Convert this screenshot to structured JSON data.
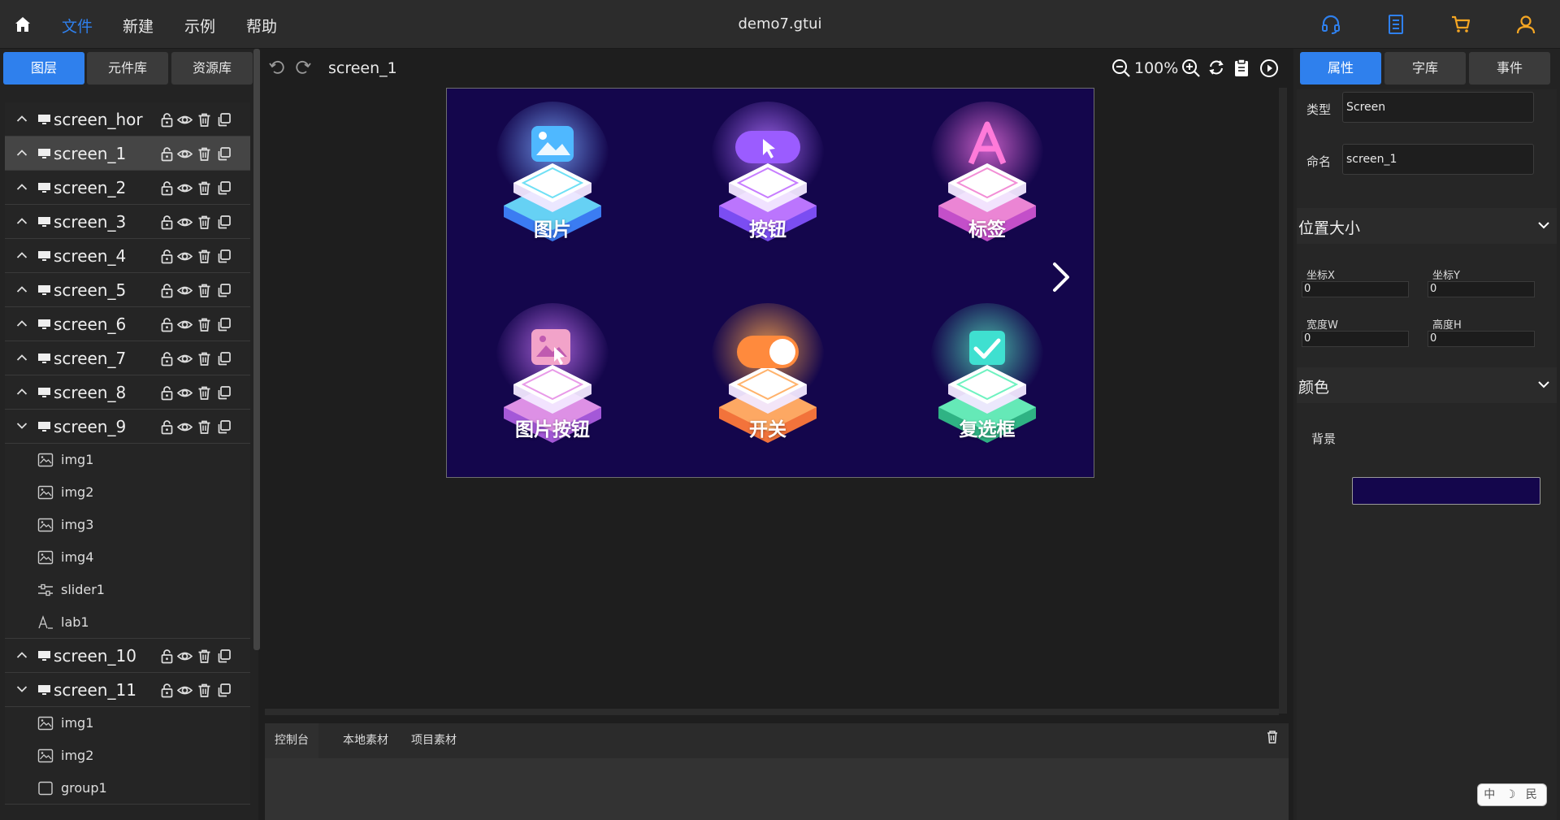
{
  "topbar": {
    "menus": [
      "文件",
      "新建",
      "示例",
      "帮助"
    ],
    "title": "demo7.gtui",
    "icons": [
      "headset-icon",
      "document-icon",
      "cart-icon",
      "user-icon"
    ],
    "accent": "#2f80ed",
    "icon_color": "#2f80ed",
    "cart_color": "#f5a623"
  },
  "left": {
    "tabs": [
      "图层",
      "元件库",
      "资源库"
    ],
    "screens": [
      {
        "name": "screen_hor",
        "expanded": false,
        "active": false,
        "children": []
      },
      {
        "name": "screen_1",
        "expanded": false,
        "active": true,
        "children": []
      },
      {
        "name": "screen_2",
        "expanded": false,
        "active": false,
        "children": []
      },
      {
        "name": "screen_3",
        "expanded": false,
        "active": false,
        "children": []
      },
      {
        "name": "screen_4",
        "expanded": false,
        "active": false,
        "children": []
      },
      {
        "name": "screen_5",
        "expanded": false,
        "active": false,
        "children": []
      },
      {
        "name": "screen_6",
        "expanded": false,
        "active": false,
        "children": []
      },
      {
        "name": "screen_7",
        "expanded": false,
        "active": false,
        "children": []
      },
      {
        "name": "screen_8",
        "expanded": false,
        "active": false,
        "children": []
      },
      {
        "name": "screen_9",
        "expanded": true,
        "active": false,
        "children": [
          {
            "name": "img1",
            "icon": "image"
          },
          {
            "name": "img2",
            "icon": "image"
          },
          {
            "name": "img3",
            "icon": "image"
          },
          {
            "name": "img4",
            "icon": "image"
          },
          {
            "name": "slider1",
            "icon": "slider"
          },
          {
            "name": "lab1",
            "icon": "label"
          }
        ]
      },
      {
        "name": "screen_10",
        "expanded": false,
        "active": false,
        "children": []
      },
      {
        "name": "screen_11",
        "expanded": true,
        "active": false,
        "children": [
          {
            "name": "img1",
            "icon": "image"
          },
          {
            "name": "img2",
            "icon": "image"
          },
          {
            "name": "group1",
            "icon": "group"
          }
        ]
      }
    ]
  },
  "center": {
    "screen_name": "screen_1",
    "zoom": "100%",
    "canvas_bg": "#14064c",
    "widgets": [
      {
        "label": "图片",
        "top": "#6fe0f5",
        "base": "#3b7cf2",
        "glow": "#7aa8ff",
        "icon": "image"
      },
      {
        "label": "按钮",
        "top": "#c77dff",
        "base": "#7b4df2",
        "glow": "#b070ff",
        "icon": "button"
      },
      {
        "label": "标签",
        "top": "#f28ed6",
        "base": "#c34fc9",
        "glow": "#e06ad8",
        "icon": "label"
      },
      {
        "label": "图片按钮",
        "top": "#e89ae8",
        "base": "#a458d8",
        "glow": "#c070f0",
        "icon": "imagebutton"
      },
      {
        "label": "开关",
        "top": "#ffb26b",
        "base": "#f2733b",
        "glow": "#ffa84d",
        "icon": "switch"
      },
      {
        "label": "复选框",
        "top": "#6ef2c0",
        "base": "#2fb384",
        "glow": "#52d6b8",
        "icon": "checkbox"
      }
    ]
  },
  "console": {
    "tabs": [
      "控制台",
      "本地素材",
      "项目素材"
    ]
  },
  "right": {
    "tabs": [
      "属性",
      "字库",
      "事件"
    ],
    "type_label": "类型",
    "type_value": "Screen",
    "name_label": "命名",
    "name_value": "screen_1",
    "section_pos": "位置大小",
    "pos_fields": [
      {
        "label": "坐标X",
        "value": "0"
      },
      {
        "label": "坐标Y",
        "value": "0"
      },
      {
        "label": "宽度W",
        "value": "0"
      },
      {
        "label": "高度H",
        "value": "0"
      }
    ],
    "section_color": "颜色",
    "bg_label": "背景",
    "bg_color": "#14064c"
  },
  "ime": {
    "text": "中 ☽ ⺠"
  }
}
